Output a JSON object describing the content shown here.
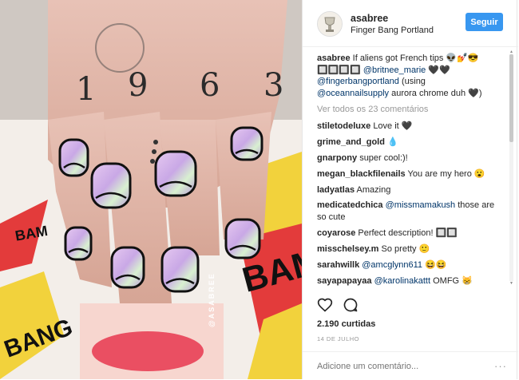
{
  "post": {
    "username": "asabree",
    "location": "Finger Bang Portland",
    "follow_label": "Seguir",
    "watermark": "@ASABREE"
  },
  "caption": {
    "user": "asabree",
    "text_1": "If aliens got French tips 👽💅😎",
    "text_2": "🔲🔲🔲🔲",
    "mention_1": "@britnee_marie",
    "text_3": "🖤🖤",
    "mention_2": "@fingerbangportland",
    "text_4": "(using",
    "mention_3": "@oceannailsupply",
    "text_5": "aurora chrome duh 🖤)"
  },
  "view_all": "Ver todos os 23 comentários",
  "comments": [
    {
      "user": "stiletodeluxe",
      "mention": "",
      "text": "Love it 🖤"
    },
    {
      "user": "grime_and_gold",
      "mention": "",
      "text": "💧"
    },
    {
      "user": "gnarpony",
      "mention": "",
      "text": "super cool:)!"
    },
    {
      "user": "megan_blackfilenails",
      "mention": "",
      "text": "You are my hero 😮"
    },
    {
      "user": "ladyatlas",
      "mention": "",
      "text": "Amazing"
    },
    {
      "user": "medicatedchica",
      "mention": "@missmamakush",
      "text": "those are so cute"
    },
    {
      "user": "coyarose",
      "mention": "",
      "text": "Perfect description! 🔲🔲"
    },
    {
      "user": "misschelsey.m",
      "mention": "",
      "text": "So pretty 🙂"
    },
    {
      "user": "sarahwillk",
      "mention": "@amcglynn611",
      "text": "😆😆"
    },
    {
      "user": "sayapapayaa",
      "mention": "@karolinakattt",
      "text": "OMFG 😸"
    }
  ],
  "actions": {
    "like_icon": "heart-icon",
    "comment_icon": "speech-bubble-icon"
  },
  "likes": "2.190 curtidas",
  "date": "14 DE JULHO",
  "add_comment_placeholder": "Adicione um comentário...",
  "more_options": "···"
}
